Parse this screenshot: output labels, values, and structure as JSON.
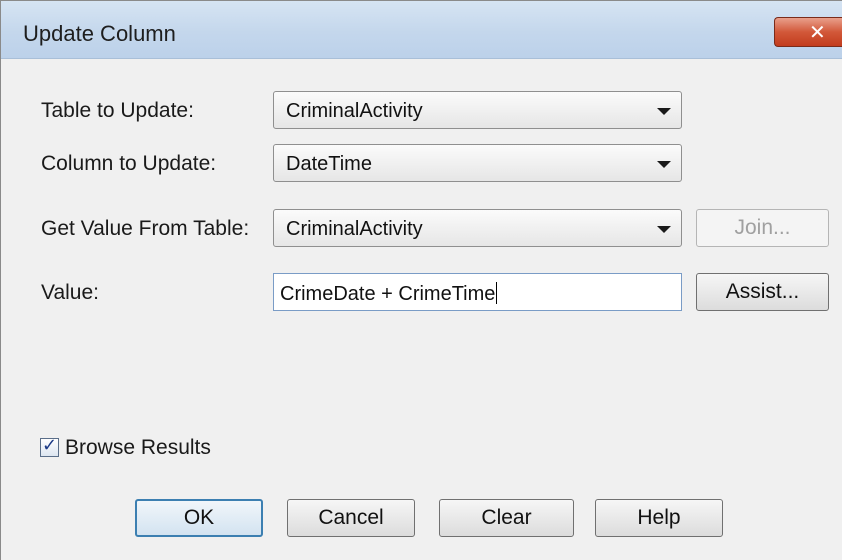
{
  "window": {
    "title": "Update Column",
    "close_glyph": "✕",
    "close_icon": "close-icon"
  },
  "form": {
    "table_to_update": {
      "label": "Table to Update:",
      "value": "CriminalActivity"
    },
    "column_to_update": {
      "label": "Column to Update:",
      "value": "DateTime"
    },
    "get_value_from_table": {
      "label": "Get Value From Table:",
      "value": "CriminalActivity"
    },
    "value": {
      "label": "Value:",
      "value": "CrimeDate + CrimeTime"
    }
  },
  "side_buttons": {
    "join": "Join...",
    "assist": "Assist..."
  },
  "browse_results": {
    "label": "Browse Results",
    "checked": true,
    "check_glyph": "✓"
  },
  "buttons": {
    "ok": "OK",
    "cancel": "Cancel",
    "clear": "Clear",
    "help": "Help"
  }
}
